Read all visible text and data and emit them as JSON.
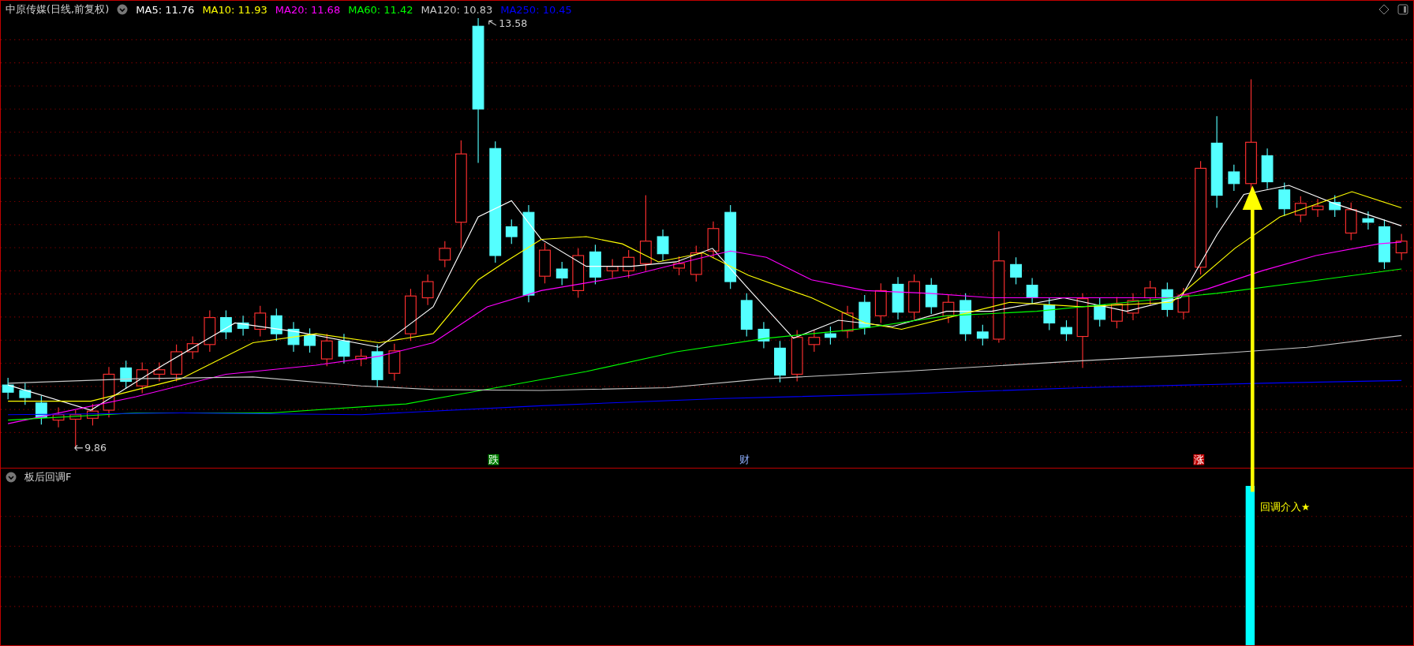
{
  "chart": {
    "title": "中原传媒(日线,前复权)",
    "moving_averages": [
      {
        "label": "MA5: 11.76",
        "color": "#ffffff"
      },
      {
        "label": "MA10: 11.93",
        "color": "#ffff00"
      },
      {
        "label": "MA20: 11.68",
        "color": "#ff00ff"
      },
      {
        "label": "MA60: 11.42",
        "color": "#00ff00"
      },
      {
        "label": "MA120: 10.83",
        "color": "#c8c8c8"
      },
      {
        "label": "MA250: 10.45",
        "color": "#0000ff"
      }
    ],
    "high_marker": "13.58",
    "low_marker": "9.86",
    "event_tags": [
      {
        "label": "跌",
        "kind": "down"
      },
      {
        "label": "财",
        "kind": "finance"
      },
      {
        "label": "涨",
        "kind": "up"
      }
    ]
  },
  "indicator": {
    "title": "板后回调F",
    "signal_label": "回调介入★"
  }
}
